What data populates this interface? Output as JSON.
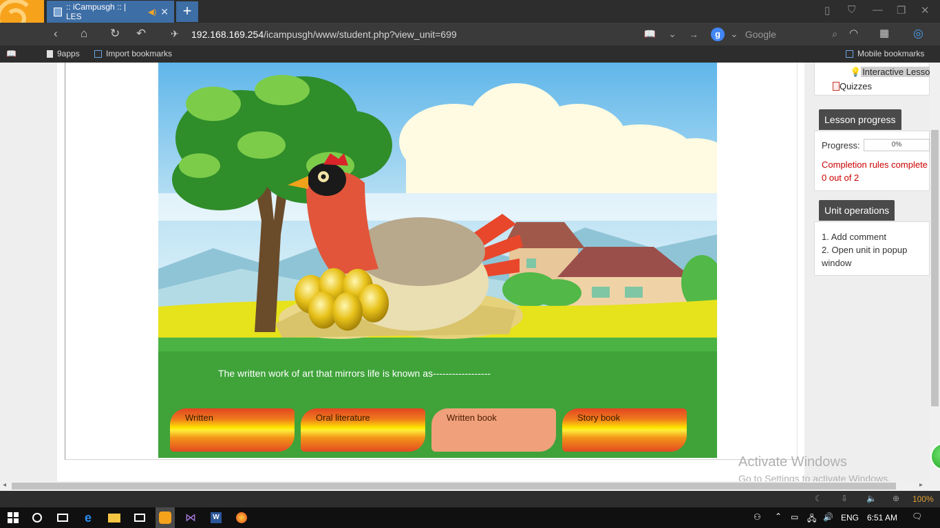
{
  "browser": {
    "tab_title": ":: iCampusgh :: | LES",
    "url_host": "192.168.169.254",
    "url_path": "/icampusgh/www/student.php?view_unit=699",
    "search_placeholder": "Google",
    "search_engine_letter": "g",
    "bookmarks": [
      "9apps",
      "Import bookmarks"
    ],
    "mobile_bookmarks": "Mobile bookmarks"
  },
  "sidebar": {
    "tree": [
      {
        "label": "Interactive Lesso",
        "icon": "lightbulb-icon",
        "selected": true
      },
      {
        "label": "Quizzes",
        "icon": "quiz-doc-icon",
        "selected": false
      }
    ],
    "lesson_progress": {
      "title": "Lesson progress",
      "progress_label": "Progress:",
      "progress_value": "0%",
      "progress_fraction": 0,
      "completion_text": "Completion rules complete",
      "completion_count": "0 out of 2"
    },
    "unit_operations": {
      "title": "Unit operations",
      "items": [
        "1. Add comment",
        "2. Open unit in popup window"
      ]
    }
  },
  "lesson": {
    "question": "The written work of art that mirrors life is known as------------------",
    "options": [
      {
        "label": "Written",
        "selected": false
      },
      {
        "label": "Oral literature",
        "selected": false
      },
      {
        "label": "Written book",
        "selected": true
      },
      {
        "label": "Story book",
        "selected": false
      }
    ]
  },
  "watermark": {
    "line1": "Activate Windows",
    "line2": "Go to Settings to activate Windows."
  },
  "statusbar": {
    "zoom": "100%"
  },
  "taskbar": {
    "language": "ENG",
    "time": "6:51 AM",
    "apps": [
      "windows-start-icon",
      "cortana-icon",
      "task-view-icon",
      "edge-icon",
      "file-explorer-icon",
      "mail-icon",
      "uc-browser-icon",
      "visual-studio-icon",
      "word-icon",
      "firefox-icon"
    ]
  },
  "colors": {
    "tab_active": "#3d6ea6",
    "sidebar_box_title": "#4a4a4a",
    "completion_text": "#cc0000",
    "grass": "#3fa33a",
    "sky": "#7fc3ea"
  }
}
